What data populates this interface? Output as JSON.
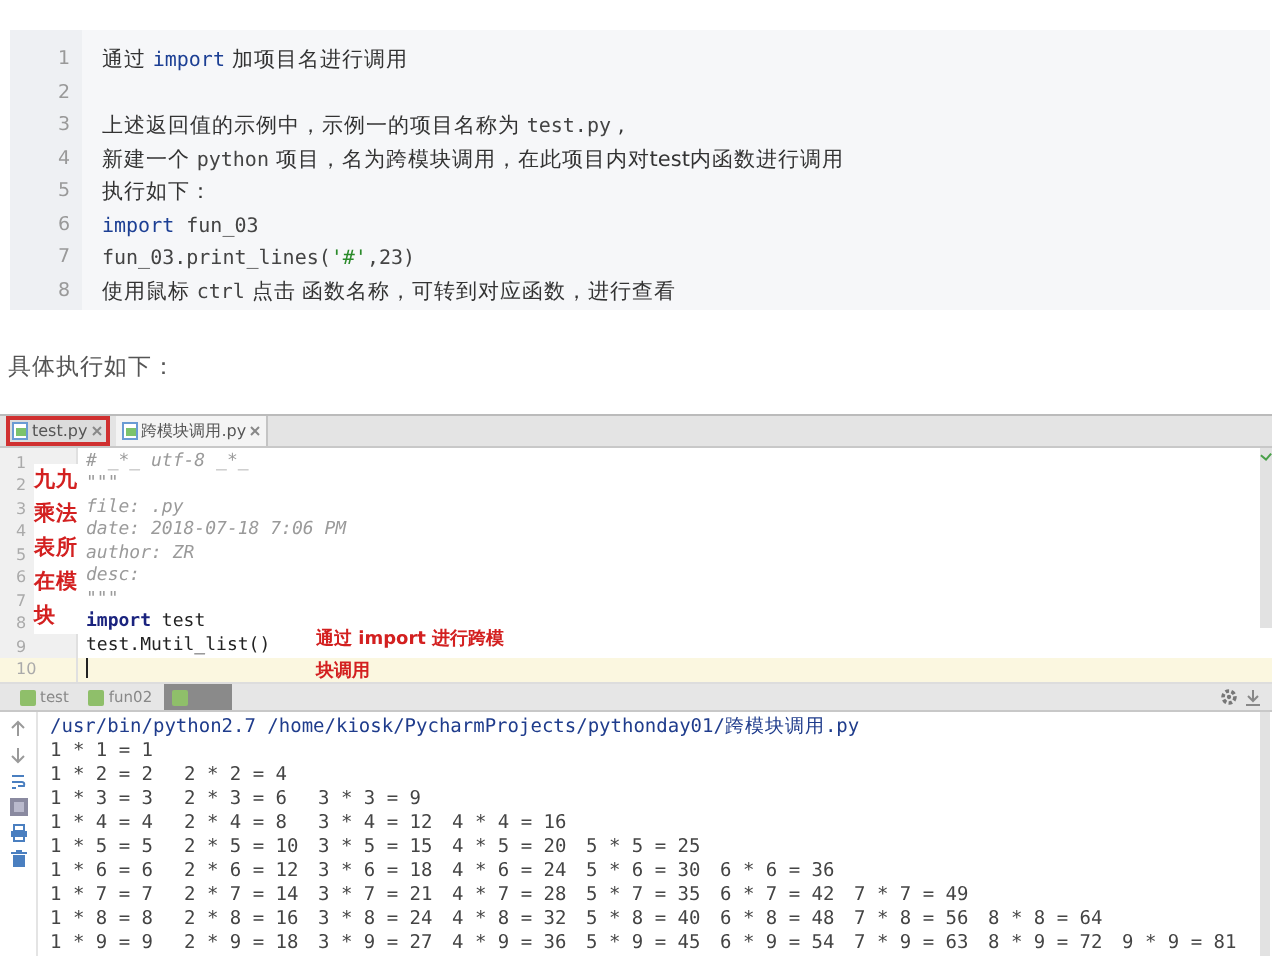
{
  "snippet": {
    "lines": [
      {
        "number": "1",
        "segments": [
          {
            "kind": "text",
            "text": "通过 "
          },
          {
            "kind": "keyword",
            "text": "import"
          },
          {
            "kind": "text",
            "text": " 加项目名进行调用"
          }
        ]
      },
      {
        "number": "2"
      },
      {
        "number": "3",
        "segments": [
          {
            "kind": "text",
            "text": "上述返回值的示例中，示例一的项目名称为 "
          },
          {
            "kind": "code",
            "text": "test.py"
          },
          {
            "kind": "text",
            "text": " ,"
          }
        ]
      },
      {
        "number": "4",
        "segments": [
          {
            "kind": "text",
            "text": "新建一个 "
          },
          {
            "kind": "code",
            "text": "python"
          },
          {
            "kind": "text",
            "text": " 项目，名为跨模块调用，在此项目内对test内函数进行调用"
          }
        ]
      },
      {
        "number": "5",
        "segments": [
          {
            "kind": "text",
            "text": "执行如下："
          }
        ]
      },
      {
        "number": "6",
        "segments": [
          {
            "kind": "keyword",
            "text": "import"
          },
          {
            "kind": "code",
            "text": " fun_03"
          }
        ]
      },
      {
        "number": "7",
        "segments": [
          {
            "kind": "code",
            "text": "fun_03.print_lines("
          },
          {
            "kind": "string",
            "text": "'#'"
          },
          {
            "kind": "code",
            "text": ",23)"
          }
        ]
      },
      {
        "number": "8",
        "segments": [
          {
            "kind": "text",
            "text": "使用鼠标 "
          },
          {
            "kind": "code",
            "text": "ctrl"
          },
          {
            "kind": "text",
            "text": " 点击 函数名称，可转到对应函数，进行查看"
          }
        ]
      }
    ]
  },
  "caption": "具体执行如下：",
  "ide": {
    "editor_tabs": [
      {
        "label": "test.py",
        "selected": false,
        "outlined": true
      },
      {
        "label": "跨模块调用.py",
        "selected": true,
        "outlined": false
      }
    ],
    "editor_lines": [
      {
        "number": "1",
        "text": "# _*_ utf-8 _*_",
        "kind": "comment",
        "current": false
      },
      {
        "number": "2",
        "text": "\"\"\"",
        "kind": "comment",
        "current": false
      },
      {
        "number": "3",
        "text": "file: .py",
        "kind": "comment",
        "current": false
      },
      {
        "number": "4",
        "text": "date: 2018-07-18 7:06 PM",
        "kind": "comment",
        "current": false
      },
      {
        "number": "5",
        "text": "author: ZR",
        "kind": "comment",
        "current": false
      },
      {
        "number": "6",
        "text": "desc:",
        "kind": "comment",
        "current": false
      },
      {
        "number": "7",
        "text": "\"\"\"",
        "kind": "comment",
        "current": false
      },
      {
        "number": "8",
        "text": "**import** test",
        "kind": "code",
        "current": false
      },
      {
        "number": "9",
        "text": "test.Mutil_list()",
        "kind": "code",
        "current": false
      },
      {
        "number": "10",
        "current": true
      }
    ],
    "annotations": [
      {
        "kind": "side",
        "text": "九九乘法表所在模块"
      },
      {
        "kind": "inline",
        "text": "通过 import 进行跨模块调用"
      }
    ],
    "run_tabs": [
      {
        "label": "test",
        "selected": false
      },
      {
        "label": "fun02",
        "selected": false
      },
      {
        "selected": true
      }
    ],
    "console": {
      "command": "/usr/bin/python2.7 /home/kiosk/PycharmProjects/pythonday01/跨模块调用.py",
      "rows": [
        [
          "1 * 1 = 1"
        ],
        [
          "1 * 2 = 2",
          "2 * 2 = 4"
        ],
        [
          "1 * 3 = 3",
          "2 * 3 = 6",
          "3 * 3 = 9"
        ],
        [
          "1 * 4 = 4",
          "2 * 4 = 8",
          "3 * 4 = 12",
          "4 * 4 = 16"
        ],
        [
          "1 * 5 = 5",
          "2 * 5 = 10",
          "3 * 5 = 15",
          "4 * 5 = 20",
          "5 * 5 = 25"
        ],
        [
          "1 * 6 = 6",
          "2 * 6 = 12",
          "3 * 6 = 18",
          "4 * 6 = 24",
          "5 * 6 = 30",
          "6 * 6 = 36"
        ],
        [
          "1 * 7 = 7",
          "2 * 7 = 14",
          "3 * 7 = 21",
          "4 * 7 = 28",
          "5 * 7 = 35",
          "6 * 7 = 42",
          "7 * 7 = 49"
        ],
        [
          "1 * 8 = 8",
          "2 * 8 = 16",
          "3 * 8 = 24",
          "4 * 8 = 32",
          "5 * 8 = 40",
          "6 * 8 = 48",
          "7 * 8 = 56",
          "8 * 8 = 64"
        ],
        [
          "1 * 9 = 9",
          "2 * 9 = 18",
          "3 * 9 = 27",
          "4 * 9 = 36",
          "5 * 9 = 45",
          "6 * 9 = 54",
          "7 * 9 = 63",
          "8 * 9 = 72",
          "9 * 9 = 81"
        ]
      ]
    }
  }
}
